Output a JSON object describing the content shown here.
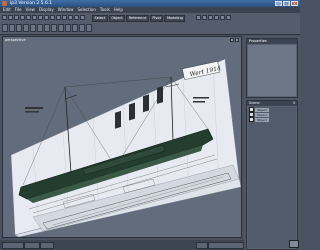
{
  "window": {
    "title": "ip3 Version 2.5.6.1"
  },
  "menu": [
    "Edit",
    "File",
    "View",
    "Display",
    "Window",
    "Selection",
    "Tools",
    "Help"
  ],
  "toolbar_tabs": [
    "Select",
    "Object",
    "Reference",
    "Pivot",
    "Modeling"
  ],
  "viewport": {
    "label": "perspective",
    "title_text": "Wert 1914"
  },
  "sidebar": {
    "panel_top_label": "Properties",
    "panel_scene_label": "Scene",
    "panel_scene_count": "3",
    "scene_items": [
      "Object",
      "Object",
      "Object"
    ]
  },
  "colors": {
    "accent_title": "#2e5d92",
    "ui_dark": "#3b4250",
    "hull": "#233d2f"
  }
}
